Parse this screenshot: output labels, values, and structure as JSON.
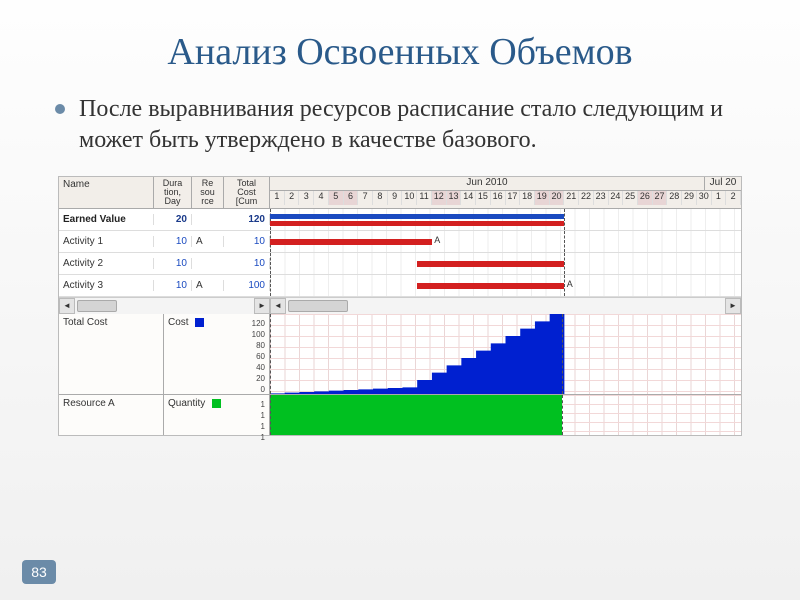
{
  "title": "Анализ Освоенных Объемов",
  "bullet": "После выравнивания ресурсов расписание стало следующим и может быть утверждено в качестве базового.",
  "page_number": "83",
  "table": {
    "headers": {
      "name": "Name",
      "duration": "Dura\ntion,\nDay",
      "resource": "Re\nsou\nrce",
      "cost": "Total\nCost\n[Cum"
    },
    "timeline": {
      "month1": "Jun 2010",
      "month2": "Jul 20",
      "days": [
        "1",
        "2",
        "3",
        "4",
        "5",
        "6",
        "7",
        "8",
        "9",
        "10",
        "11",
        "12",
        "13",
        "14",
        "15",
        "16",
        "17",
        "18",
        "19",
        "20",
        "21",
        "22",
        "23",
        "24",
        "25",
        "26",
        "27",
        "28",
        "29",
        "30",
        "1",
        "2"
      ],
      "weekend_indices": [
        4,
        5,
        11,
        12,
        18,
        19,
        25,
        26
      ]
    },
    "rows": [
      {
        "name": "Earned Value",
        "duration": "20",
        "resource": "",
        "cost": "120",
        "bold": true
      },
      {
        "name": "Activity 1",
        "duration": "10",
        "resource": "A",
        "cost": "10",
        "bold": false
      },
      {
        "name": "Activity 2",
        "duration": "10",
        "resource": "",
        "cost": "10",
        "bold": false
      },
      {
        "name": "Activity 3",
        "duration": "10",
        "resource": "A",
        "cost": "100",
        "bold": false
      }
    ],
    "scroll_arrows": {
      "left": "◄",
      "right": "►",
      "left2": "◄",
      "right2": "►"
    }
  },
  "cost_section": {
    "label": "Total Cost",
    "legend": "Cost",
    "y_ticks": [
      "120",
      "100",
      "80",
      "60",
      "40",
      "20",
      "0"
    ]
  },
  "resource_section": {
    "label": "Resource A",
    "legend": "Quantity",
    "y_ticks": [
      "1",
      "1",
      "1",
      "1"
    ]
  },
  "chart_data": {
    "type": "gantt-with-profiles",
    "gantt": {
      "timeline_start": "2010-06-01",
      "timeline_end": "2010-07-02",
      "bars": [
        {
          "row": "Earned Value",
          "style": "summary-blue",
          "start_day": 1,
          "end_day": 20
        },
        {
          "row": "Earned Value",
          "style": "summary-red",
          "start_day": 1,
          "end_day": 20
        },
        {
          "row": "Activity 1",
          "style": "red",
          "start_day": 1,
          "end_day": 11,
          "label_end": "A"
        },
        {
          "row": "Activity 2",
          "style": "red",
          "start_day": 11,
          "end_day": 20
        },
        {
          "row": "Activity 3",
          "style": "red",
          "start_day": 11,
          "end_day": 20,
          "label_end": "A"
        }
      ]
    },
    "cost_profile": {
      "type": "area",
      "ylabel": "Cost",
      "ylim": [
        0,
        120
      ],
      "x_days": [
        1,
        2,
        3,
        4,
        5,
        6,
        7,
        8,
        9,
        10,
        11,
        12,
        13,
        14,
        15,
        16,
        17,
        18,
        19,
        20
      ],
      "cumulative_values": [
        1,
        2,
        3,
        4,
        5,
        6,
        7,
        8,
        9,
        10,
        21,
        32,
        43,
        54,
        65,
        76,
        87,
        98,
        109,
        120
      ]
    },
    "resource_profile": {
      "type": "bar",
      "ylabel": "Quantity",
      "ylim": [
        0,
        1
      ],
      "x_days": [
        1,
        2,
        3,
        4,
        5,
        6,
        7,
        8,
        9,
        10,
        11,
        12,
        13,
        14,
        15,
        16,
        17,
        18,
        19,
        20
      ],
      "values": [
        1,
        1,
        1,
        1,
        1,
        1,
        1,
        1,
        1,
        1,
        1,
        1,
        1,
        1,
        1,
        1,
        1,
        1,
        1,
        1
      ]
    }
  }
}
